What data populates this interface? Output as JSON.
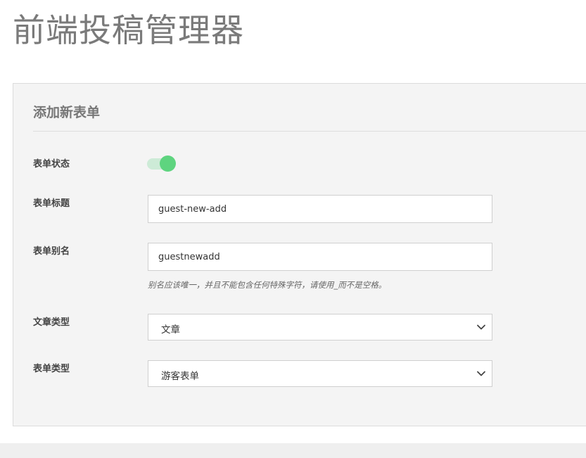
{
  "page": {
    "title": "前端投稿管理器"
  },
  "form": {
    "heading": "添加新表单",
    "status": {
      "label": "表单状态",
      "enabled": true
    },
    "title_field": {
      "label": "表单标题",
      "value": "guest-new-add"
    },
    "alias_field": {
      "label": "表单别名",
      "value": "guestnewadd",
      "hint": "别名应该唯一，并且不能包含任何特殊字符，请使用_而不是空格。"
    },
    "post_type": {
      "label": "文章类型",
      "selected": "文章"
    },
    "form_type": {
      "label": "表单类型",
      "selected": "游客表单"
    }
  },
  "colors": {
    "toggle_on": "#5ed47f",
    "toggle_track": "#cdebd7",
    "title_gray": "#7a7a7a",
    "panel_bg": "#f4f4f4"
  },
  "icons": {
    "select_arrow": "chevron-down-icon"
  }
}
